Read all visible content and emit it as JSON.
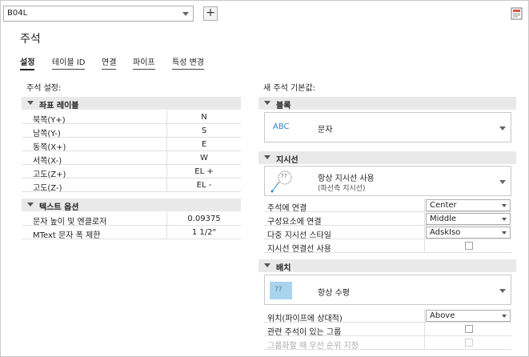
{
  "toolbar": {
    "style_combo_value": "B04L",
    "add_button_label": "+",
    "corner_icon": "style-doc-icon"
  },
  "page": {
    "title": "주석"
  },
  "tabs": [
    {
      "label": "설정",
      "active": true
    },
    {
      "label": "테이블 ID",
      "active": false
    },
    {
      "label": "연결",
      "active": false
    },
    {
      "label": "파이프",
      "active": false
    },
    {
      "label": "특성 변경",
      "active": false
    }
  ],
  "left": {
    "section_label": "주석 설정:",
    "coord_group": {
      "label": "좌표 레이블",
      "rows": [
        {
          "key": "북쪽(Y+)",
          "value": "N"
        },
        {
          "key": "남쪽(Y-)",
          "value": "S"
        },
        {
          "key": "동쪽(X+)",
          "value": "E"
        },
        {
          "key": "서쪽(X-)",
          "value": "W"
        },
        {
          "key": "고도(Z+)",
          "value": "EL +"
        },
        {
          "key": "고도(Z-)",
          "value": "EL -"
        }
      ]
    },
    "text_group": {
      "label": "텍스트 옵션",
      "rows": [
        {
          "key": "문자 높이 및 엔클로저",
          "value": "0.09375"
        },
        {
          "key": "MText 문자 폭 제한",
          "value": "1 1/2\""
        }
      ]
    }
  },
  "right": {
    "section_label": "새 주석 기본값:",
    "block_group": {
      "label": "블록",
      "dropdown": {
        "icon_text": "ABC",
        "text": "문자"
      }
    },
    "leader_group": {
      "label": "지시선",
      "dropdown": {
        "icon_text": "??",
        "text": "항상 지시선 사용",
        "subtext": "(파선측 지시선)"
      },
      "rows": [
        {
          "key": "주석에 연결",
          "value": "Center"
        },
        {
          "key": "구성요소에 연결",
          "value": "Middle"
        },
        {
          "key": "다중 지시선 스타일",
          "value": "AdskIso"
        }
      ],
      "check_row": {
        "key": "지시선 연결선 사용",
        "checked": false
      }
    },
    "placement_group": {
      "label": "배치",
      "dropdown": {
        "icon_text": "??",
        "text": "항상 수평"
      },
      "rows": [
        {
          "key": "위치(파이프에 상대적)",
          "value": "Above"
        }
      ],
      "check_rows": [
        {
          "key": "관련 주석이 있는 그룹",
          "checked": false,
          "disabled": false
        },
        {
          "key": "그룹화할 때 우선 순위 지정",
          "checked": false,
          "disabled": true
        }
      ]
    }
  },
  "colors": {
    "group_header_bg": "#e9e9e9",
    "abc_text": "#2e86c9",
    "placement_icon_bg": "#a9d4ee",
    "leader_icon_line": "#2e86c9"
  }
}
